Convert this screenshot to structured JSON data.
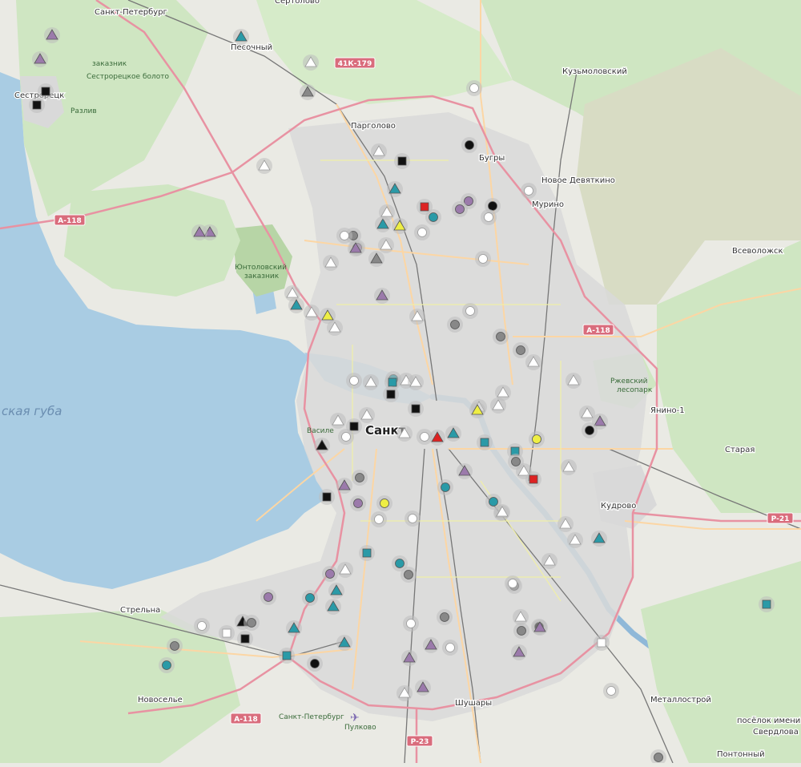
{
  "map": {
    "colors": {
      "water": "#a9cce3",
      "land": "#eaeae4",
      "urban": "#d9d9d9",
      "green": "#cfe6c2",
      "forest": "#b7d5a6",
      "swamp": "#d8dcc4",
      "motorway": "#e892a2",
      "primary": "#fcd6a4",
      "secondary": "#f7fabf",
      "rail": "#777777",
      "river": "#8fb8d8"
    },
    "places": [
      {
        "id": "sertolovo",
        "name": "Сертолово",
        "cls": "pl"
      },
      {
        "id": "sankt-peterburg-top",
        "name": "Санкт-Петербург",
        "cls": "pl"
      },
      {
        "id": "pesochny",
        "name": "Песочный",
        "cls": "pl"
      },
      {
        "id": "sestroretsk",
        "name": "Сестрорецк",
        "cls": "pl"
      },
      {
        "id": "kuzmolovsky",
        "name": "Кузьмоловский",
        "cls": "pl"
      },
      {
        "id": "pargolovo",
        "name": "Парголово",
        "cls": "pl"
      },
      {
        "id": "bugry",
        "name": "Бугры",
        "cls": "pl"
      },
      {
        "id": "novoe-devyatkino",
        "name": "Новое Девяткино",
        "cls": "pl"
      },
      {
        "id": "murino",
        "name": "Мурино",
        "cls": "pl"
      },
      {
        "id": "vsevolozhsk",
        "name": "Всеволожск",
        "cls": "pl"
      },
      {
        "id": "yanino",
        "name": "Янино-1",
        "cls": "pl"
      },
      {
        "id": "staraya",
        "name": "Старая",
        "cls": "pl"
      },
      {
        "id": "kudrovo",
        "name": "Кудрово",
        "cls": "pl"
      },
      {
        "id": "strelna",
        "name": "Стрельна",
        "cls": "pl"
      },
      {
        "id": "novoselye",
        "name": "Новоселье",
        "cls": "pl"
      },
      {
        "id": "shushary",
        "name": "Шушары",
        "cls": "pl"
      },
      {
        "id": "metallostroy",
        "name": "Металлострой",
        "cls": "pl"
      },
      {
        "id": "poselok-imeni",
        "name": "посёлок имени",
        "cls": "pl"
      },
      {
        "id": "sverdlova",
        "name": "Свердлова",
        "cls": "pl"
      },
      {
        "id": "pontonny",
        "name": "Понтонный",
        "cls": "pl"
      },
      {
        "id": "zakaznik",
        "name": "заказник",
        "cls": "pl-park"
      },
      {
        "id": "sestroretskoe-boloto",
        "name": "Сестрорецкое болото",
        "cls": "pl-park"
      },
      {
        "id": "razliv",
        "name": "Разлив",
        "cls": "pl-park"
      },
      {
        "id": "yuntolovsky",
        "name": "Юнтоловский",
        "cls": "pl-park"
      },
      {
        "id": "yuntolovsky-zakaznik",
        "name": "заказник",
        "cls": "pl-park"
      },
      {
        "id": "rzhevsky",
        "name": "Ржевский",
        "cls": "pl-park"
      },
      {
        "id": "rzhevsky-2",
        "name": "лесопарк",
        "cls": "pl-park"
      },
      {
        "id": "gulf",
        "name": "ская губа",
        "cls": "pl-water"
      },
      {
        "id": "city-center",
        "name": "Санкт",
        "cls": "pl-city"
      },
      {
        "id": "vasileostrovsky",
        "name": "Василе",
        "cls": "pl-park"
      },
      {
        "id": "pulkovo",
        "name": "Пулково",
        "cls": "pl-park"
      },
      {
        "id": "airport-road",
        "name": "Санкт-Петербург",
        "cls": "pl-park"
      }
    ],
    "road_shields": [
      {
        "id": "a118-west",
        "label": "А-118"
      },
      {
        "id": "a118-east",
        "label": "А-118"
      },
      {
        "id": "a118-south",
        "label": "А-118"
      },
      {
        "id": "41k179",
        "label": "41К-179"
      },
      {
        "id": "r21",
        "label": "Р-21"
      },
      {
        "id": "r23",
        "label": "Р-23"
      }
    ],
    "markers": [
      {
        "t": "triangle",
        "c": "#9b7aab"
      },
      {
        "t": "triangle",
        "c": "#9b7aab"
      },
      {
        "t": "triangle",
        "c": "#2a9aa7"
      },
      {
        "t": "square",
        "c": "#111111"
      },
      {
        "t": "square",
        "c": "#111111"
      },
      {
        "t": "triangle",
        "c": "#ffffff"
      },
      {
        "t": "triangle",
        "c": "#888888"
      },
      {
        "t": "circle",
        "c": "#ffffff"
      },
      {
        "t": "circle",
        "c": "#111111"
      },
      {
        "t": "triangle",
        "c": "#ffffff"
      },
      {
        "t": "square",
        "c": "#111111"
      },
      {
        "t": "triangle",
        "c": "#ffffff"
      },
      {
        "t": "triangle",
        "c": "#2a9aa7"
      },
      {
        "t": "circle",
        "c": "#ffffff"
      },
      {
        "t": "square",
        "c": "#dd2222"
      },
      {
        "t": "circle",
        "c": "#9b7aab"
      },
      {
        "t": "circle",
        "c": "#9b7aab"
      },
      {
        "t": "circle",
        "c": "#111111"
      },
      {
        "t": "circle",
        "c": "#2a9aa7"
      },
      {
        "t": "circle",
        "c": "#ffffff"
      },
      {
        "t": "circle",
        "c": "#ffffff"
      },
      {
        "t": "triangle",
        "c": "#9b7aab"
      },
      {
        "t": "triangle",
        "c": "#2a9aa7"
      },
      {
        "t": "triangle",
        "c": "#ffffff"
      },
      {
        "t": "triangle",
        "c": "#eeee44"
      },
      {
        "t": "circle",
        "c": "#888888"
      },
      {
        "t": "circle",
        "c": "#ffffff"
      },
      {
        "t": "circle",
        "c": "#9b7aab"
      },
      {
        "t": "triangle",
        "c": "#9b7aab"
      },
      {
        "t": "triangle",
        "c": "#ffffff"
      },
      {
        "t": "triangle",
        "c": "#888888"
      },
      {
        "t": "triangle",
        "c": "#ffffff"
      },
      {
        "t": "circle",
        "c": "#ffffff"
      },
      {
        "t": "triangle",
        "c": "#9b7aab"
      },
      {
        "t": "triangle",
        "c": "#ffffff"
      },
      {
        "t": "triangle",
        "c": "#2a9aa7"
      },
      {
        "t": "triangle",
        "c": "#ffffff"
      },
      {
        "t": "triangle",
        "c": "#eeee44"
      },
      {
        "t": "triangle",
        "c": "#ffffff"
      },
      {
        "t": "circle",
        "c": "#ffffff"
      },
      {
        "t": "triangle",
        "c": "#ffffff"
      },
      {
        "t": "circle",
        "c": "#888888"
      },
      {
        "t": "circle",
        "c": "#888888"
      },
      {
        "t": "circle",
        "c": "#888888"
      },
      {
        "t": "triangle",
        "c": "#ffffff"
      },
      {
        "t": "circle",
        "c": "#ffffff"
      },
      {
        "t": "circle",
        "c": "#2a9aa7"
      },
      {
        "t": "triangle",
        "c": "#ffffff"
      },
      {
        "t": "square",
        "c": "#2a9aa7"
      },
      {
        "t": "triangle",
        "c": "#ffffff"
      },
      {
        "t": "triangle",
        "c": "#ffffff"
      },
      {
        "t": "square",
        "c": "#111111"
      },
      {
        "t": "square",
        "c": "#111111"
      },
      {
        "t": "triangle",
        "c": "#ffffff"
      },
      {
        "t": "triangle",
        "c": "#ffffff"
      },
      {
        "t": "square",
        "c": "#111111"
      },
      {
        "t": "circle",
        "c": "#ffffff"
      },
      {
        "t": "triangle",
        "c": "#ffffff"
      },
      {
        "t": "triangle",
        "c": "#ffffff"
      },
      {
        "t": "triangle",
        "c": "#dd2222"
      },
      {
        "t": "triangle",
        "c": "#2a9aa7"
      },
      {
        "t": "triangle",
        "c": "#ffffff"
      },
      {
        "t": "circle",
        "c": "#ffffff"
      },
      {
        "t": "triangle",
        "c": "#ffffff"
      },
      {
        "t": "triangle",
        "c": "#eeee44"
      },
      {
        "t": "triangle",
        "c": "#ffffff"
      },
      {
        "t": "triangle",
        "c": "#ffffff"
      },
      {
        "t": "triangle",
        "c": "#9b7aab"
      },
      {
        "t": "triangle",
        "c": "#111111"
      },
      {
        "t": "triangle",
        "c": "#9b7aab"
      },
      {
        "t": "circle",
        "c": "#2a9aa7"
      },
      {
        "t": "square",
        "c": "#2a9aa7"
      },
      {
        "t": "circle",
        "c": "#111111"
      },
      {
        "t": "triangle",
        "c": "#ffffff"
      },
      {
        "t": "square",
        "c": "#dd2222"
      },
      {
        "t": "circle",
        "c": "#eeee44"
      },
      {
        "t": "triangle",
        "c": "#ffffff"
      },
      {
        "t": "triangle",
        "c": "#ffffff"
      },
      {
        "t": "square",
        "c": "#2a9aa7"
      },
      {
        "t": "circle",
        "c": "#888888"
      },
      {
        "t": "circle",
        "c": "#eeee44"
      },
      {
        "t": "square",
        "c": "#111111"
      },
      {
        "t": "triangle",
        "c": "#9b7aab"
      },
      {
        "t": "circle",
        "c": "#888888"
      },
      {
        "t": "circle",
        "c": "#ffffff"
      },
      {
        "t": "circle",
        "c": "#ffffff"
      },
      {
        "t": "circle",
        "c": "#2a9aa7"
      },
      {
        "t": "triangle",
        "c": "#ffffff"
      },
      {
        "t": "triangle",
        "c": "#ffffff"
      },
      {
        "t": "triangle",
        "c": "#2a9aa7"
      },
      {
        "t": "triangle",
        "c": "#ffffff"
      },
      {
        "t": "circle",
        "c": "#9b7aab"
      },
      {
        "t": "circle",
        "c": "#888888"
      },
      {
        "t": "triangle",
        "c": "#ffffff"
      },
      {
        "t": "circle",
        "c": "#9b7aab"
      },
      {
        "t": "triangle",
        "c": "#ffffff"
      },
      {
        "t": "triangle",
        "c": "#2a9aa7"
      },
      {
        "t": "circle",
        "c": "#2a9aa7"
      },
      {
        "t": "circle",
        "c": "#888888"
      },
      {
        "t": "square",
        "c": "#2a9aa7"
      },
      {
        "t": "circle",
        "c": "#2a9aa7"
      },
      {
        "t": "triangle",
        "c": "#2a9aa7"
      },
      {
        "t": "triangle",
        "c": "#111111"
      },
      {
        "t": "circle",
        "c": "#888888"
      },
      {
        "t": "circle",
        "c": "#9b7aab"
      },
      {
        "t": "square",
        "c": "#ffffff"
      },
      {
        "t": "square",
        "c": "#111111"
      },
      {
        "t": "triangle",
        "c": "#2a9aa7"
      },
      {
        "t": "square",
        "c": "#2a9aa7"
      },
      {
        "t": "circle",
        "c": "#2a9aa7"
      },
      {
        "t": "triangle",
        "c": "#2a9aa7"
      },
      {
        "t": "circle",
        "c": "#888888"
      },
      {
        "t": "circle",
        "c": "#111111"
      },
      {
        "t": "circle",
        "c": "#ffffff"
      },
      {
        "t": "triangle",
        "c": "#9b7aab"
      },
      {
        "t": "circle",
        "c": "#ffffff"
      },
      {
        "t": "triangle",
        "c": "#9b7aab"
      },
      {
        "t": "triangle",
        "c": "#ffffff"
      },
      {
        "t": "circle",
        "c": "#888888"
      },
      {
        "t": "circle",
        "c": "#111111"
      },
      {
        "t": "triangle",
        "c": "#9b7aab"
      },
      {
        "t": "square",
        "c": "#ffffff"
      },
      {
        "t": "circle",
        "c": "#ffffff"
      },
      {
        "t": "square",
        "c": "#2a9aa7"
      },
      {
        "t": "circle",
        "c": "#888888"
      },
      {
        "t": "circle",
        "c": "#ffffff"
      },
      {
        "t": "triangle",
        "c": "#ffffff"
      },
      {
        "t": "triangle",
        "c": "#9b7aab"
      },
      {
        "t": "circle",
        "c": "#ffffff"
      },
      {
        "t": "triangle",
        "c": "#9b7aab"
      },
      {
        "t": "circle",
        "c": "#888888"
      },
      {
        "t": "triangle",
        "c": "#9b7aab"
      }
    ]
  }
}
